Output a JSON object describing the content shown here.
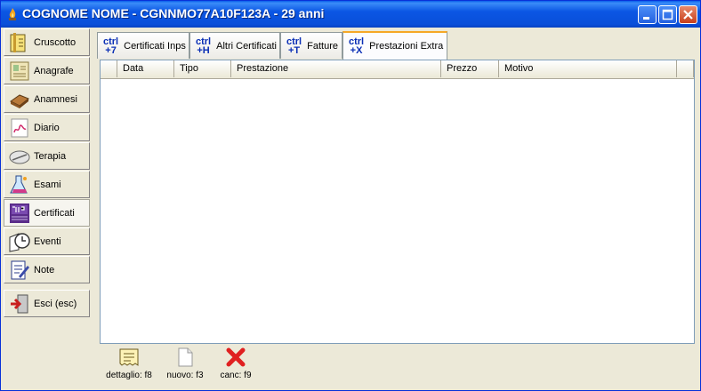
{
  "window": {
    "title": "COGNOME NOME - CGNNMO77A10F123A - 29 anni",
    "accent": "#0A4FD9"
  },
  "sidebar": {
    "items": [
      {
        "label": "Cruscotto",
        "icon": "dashboard-icon"
      },
      {
        "label": "Anagrafe",
        "icon": "registry-icon"
      },
      {
        "label": "Anamnesi",
        "icon": "history-icon"
      },
      {
        "label": "Diario",
        "icon": "diary-icon"
      },
      {
        "label": "Terapia",
        "icon": "pill-icon"
      },
      {
        "label": "Esami",
        "icon": "lab-flask-icon"
      },
      {
        "label": "Certificati",
        "icon": "inps-certificate-icon"
      },
      {
        "label": "Eventi",
        "icon": "clock-icon"
      },
      {
        "label": "Note",
        "icon": "note-icon"
      },
      {
        "label": "Esci (esc)",
        "icon": "exit-icon"
      }
    ],
    "active_index": 6
  },
  "tabs": [
    {
      "shortcut": "ctrl\n+7",
      "label": "Certificati Inps"
    },
    {
      "shortcut": "ctrl\n+H",
      "label": "Altri Certificati"
    },
    {
      "shortcut": "ctrl\n+T",
      "label": "Fatture"
    },
    {
      "shortcut": "ctrl\n+X",
      "label": "Prestazioni Extra"
    }
  ],
  "active_tab": 3,
  "table": {
    "columns": [
      "Data",
      "Tipo",
      "Prestazione",
      "Prezzo",
      "Motivo"
    ],
    "rows": []
  },
  "toolbar": {
    "details_label": "dettaglio: f8",
    "new_label": "nuovo: f3",
    "delete_label": "canc: f9"
  }
}
